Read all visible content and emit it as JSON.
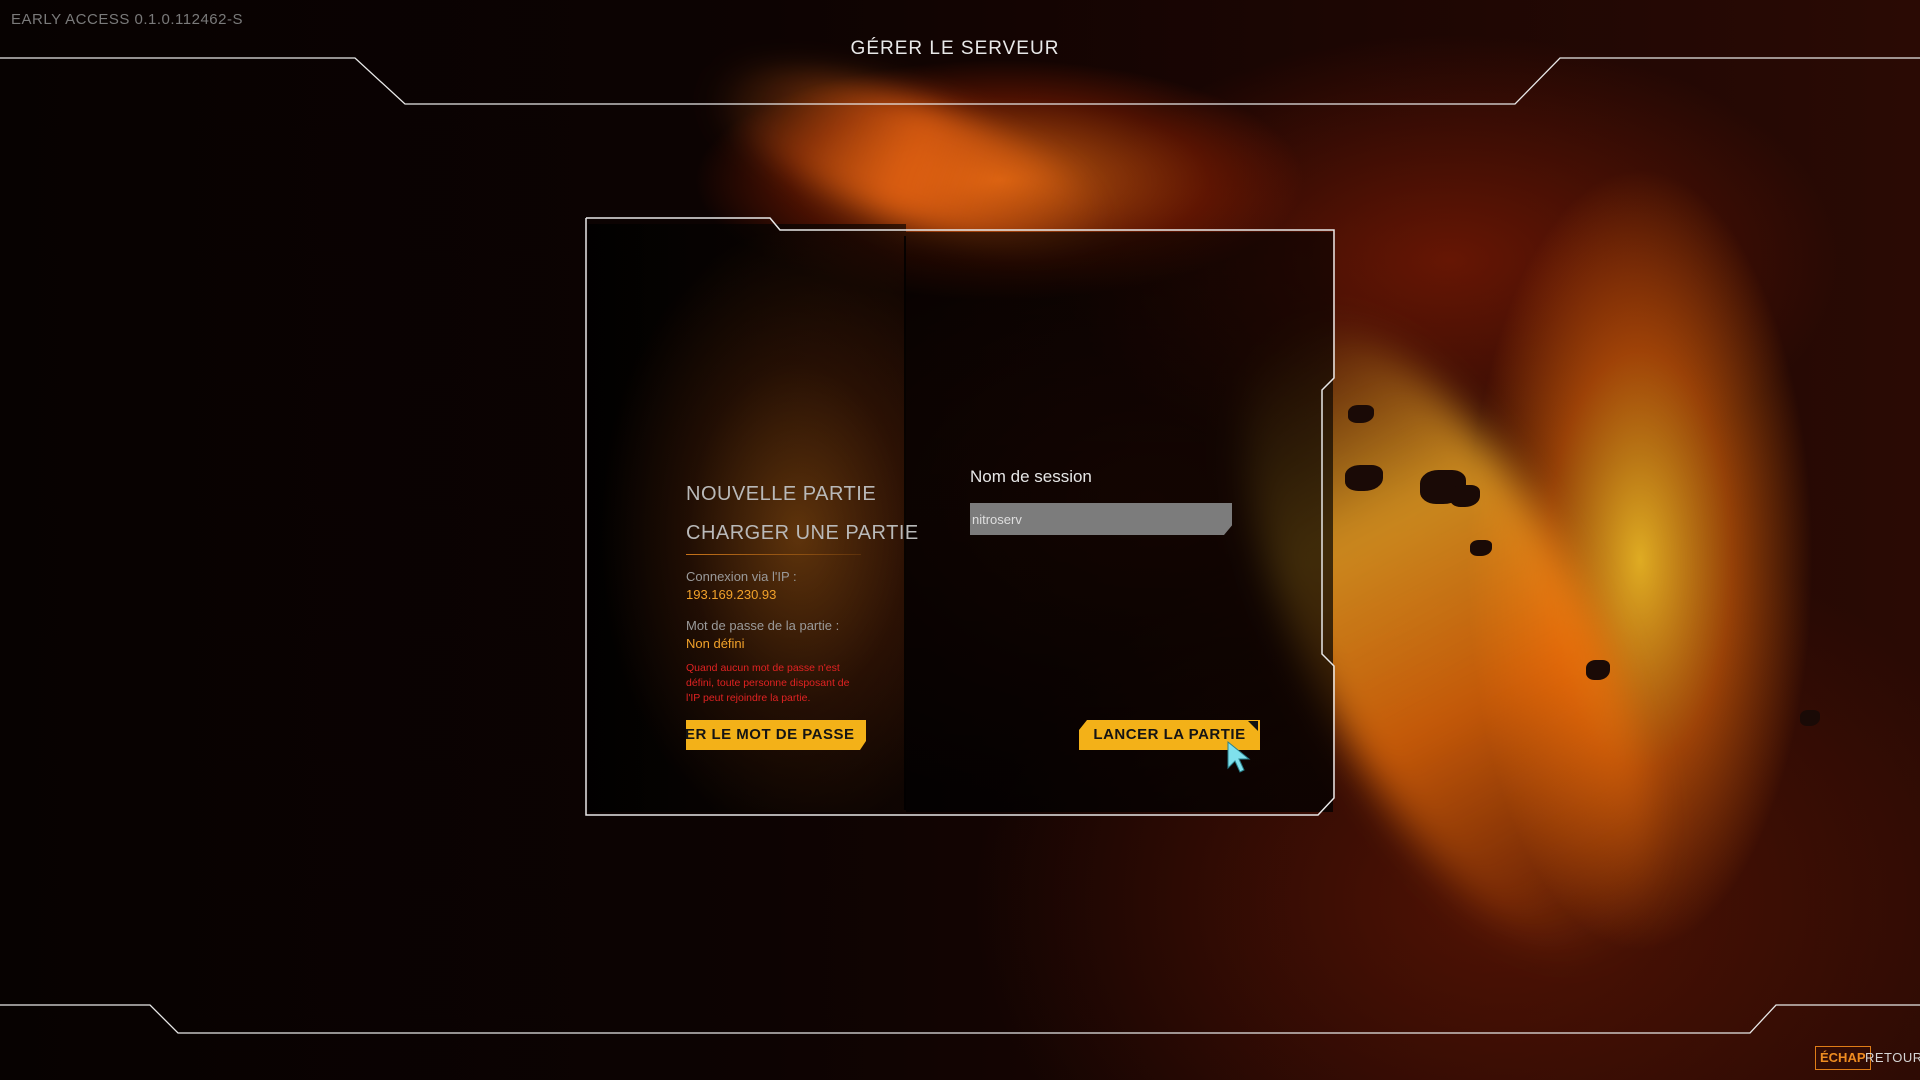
{
  "app": {
    "version": "EARLY ACCESS 0.1.0.112462-S",
    "page_title": "GÉRER LE SERVEUR"
  },
  "menu": {
    "new_game": "NOUVELLE PARTIE",
    "load_game": "CHARGER UNE PARTIE"
  },
  "info": {
    "ip_label": "Connexion via l'IP :",
    "ip_value": "193.169.230.93",
    "password_label": "Mot de passe de la partie :",
    "password_value": "Non défini",
    "warning": "Quand aucun mot de passe n'est défini, toute personne disposant de l'IP peut rejoindre la partie."
  },
  "buttons": {
    "change_password": "MODIFIER LE MOT DE PASSE",
    "launch_game": "LANCER LA PARTIE"
  },
  "session": {
    "label": "Nom de session",
    "value": "nitroserv"
  },
  "footer": {
    "esc_key": "ÉCHAP",
    "back_label": "RETOUR"
  },
  "colors": {
    "accent_yellow": "#f3b118",
    "accent_orange": "#f2a22a",
    "warning_red": "#e02222",
    "frame_line": "#e8e8e8"
  },
  "icons": {
    "cursor": "mouse-pointer-icon"
  }
}
